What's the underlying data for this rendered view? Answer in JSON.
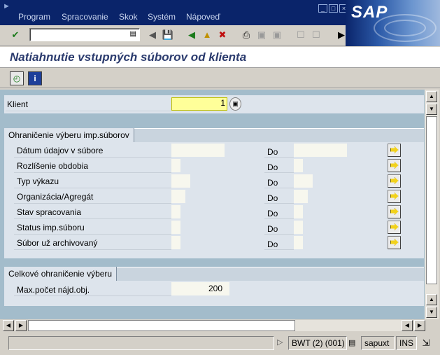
{
  "menu": {
    "items": [
      {
        "label": "Program"
      },
      {
        "label": "Spracovanie"
      },
      {
        "label": "Skok"
      },
      {
        "label": "Systém"
      },
      {
        "label": "Nápoveď"
      }
    ]
  },
  "logo": {
    "text": "SAP"
  },
  "title": "Natiahnutie vstupných súborov od klienta",
  "selection": {
    "client_label": "Klient",
    "client_value": "1",
    "group1_title": "Ohraničenie výberu imp.súborov",
    "to_label": "Do",
    "rows": [
      {
        "label": "Dátum údajov v súbore"
      },
      {
        "label": "Rozlíšenie obdobia"
      },
      {
        "label": "Typ výkazu"
      },
      {
        "label": "Organizácia/Agregát"
      },
      {
        "label": "Stav spracovania"
      },
      {
        "label": "Status imp.súboru"
      },
      {
        "label": "Súbor už archivovaný"
      }
    ],
    "group2_title": "Celkové ohraničenie výberu",
    "max_label": "Max.počet nájd.obj.",
    "max_value": "200"
  },
  "status": {
    "system": "BWT (2) (001)",
    "server": "sapuxt",
    "mode": "INS"
  },
  "colors": {
    "menubar": "#0a246a",
    "title_text": "#2b3b6e",
    "content_bg": "#a3bccb",
    "panel_bg": "#dde4ec",
    "required_field": "#ffff99"
  }
}
